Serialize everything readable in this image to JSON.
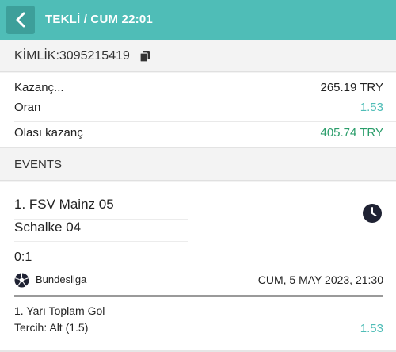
{
  "header": {
    "title": "TEKLİ / CUM 22:01"
  },
  "identity": {
    "text": "KİMLİK:3095215419"
  },
  "summary": {
    "stake_label": "Kazanç...",
    "stake_value": "265.19 TRY",
    "odds_label": "Oran",
    "odds_value": "1.53",
    "potential_label": "Olası kazanç",
    "potential_value": "405.74 TRY"
  },
  "events_header": "EVENTS",
  "event": {
    "home": "1. FSV Mainz 05",
    "away": "Schalke 04",
    "score": "0:1",
    "league": "Bundesliga",
    "datetime": "CUM, 5 MAY 2023, 21:30",
    "market": "1. Yarı Toplam Gol",
    "pick": "Tercih: Alt (1.5)",
    "pick_odds": "1.53"
  },
  "colors": {
    "accent": "#4fbdb7",
    "positive": "#2a9d6a"
  }
}
